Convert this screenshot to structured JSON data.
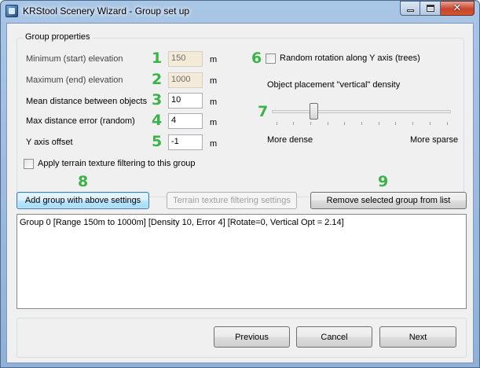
{
  "window": {
    "title": "KRStool Scenery Wizard - Group set up",
    "caption_buttons": [
      "minimize",
      "maximize",
      "close"
    ],
    "close_glyph": "✕"
  },
  "group_properties": {
    "title": "Group properties",
    "fields": [
      {
        "marker": "1",
        "label": "Minimum (start) elevation",
        "value": "150",
        "unit": "m",
        "enabled": false
      },
      {
        "marker": "2",
        "label": "Maximum (end) elevation",
        "value": "1000",
        "unit": "m",
        "enabled": false
      },
      {
        "marker": "3",
        "label": "Mean distance between objects",
        "value": "10",
        "unit": "m",
        "enabled": true
      },
      {
        "marker": "4",
        "label": "Max distance error (random)",
        "value": "4",
        "unit": "m",
        "enabled": true
      },
      {
        "marker": "5",
        "label": "Y axis offset",
        "value": "-1",
        "unit": "m",
        "enabled": true
      }
    ],
    "apply_texture_filtering": {
      "label": "Apply terrain texture filtering to this group",
      "checked": false
    },
    "random_rotation": {
      "marker": "6",
      "label": "Random rotation along Y axis (trees)",
      "checked": false
    },
    "density": {
      "marker": "7",
      "label": "Object placement \"vertical\" density",
      "min_label": "More dense",
      "max_label": "More sparse",
      "position_fraction": 0.22
    }
  },
  "actions": {
    "add_marker": "8",
    "add_label": "Add group with above settings",
    "filter_label": "Terrain texture filtering settings",
    "remove_marker": "9",
    "remove_label": "Remove selected group from list"
  },
  "group_list": [
    "Group 0 [Range 150m to 1000m] [Density 10, Error 4] [Rotate=0, Vertical Opt = 2.14]"
  ],
  "navigation": {
    "previous_label": "Previous",
    "cancel_label": "Cancel",
    "next_label": "Next"
  },
  "colors": {
    "marker_green": "#3cb34a",
    "disabled_field_bg": "#f4ead8",
    "default_button_border": "#3c7fb1"
  }
}
